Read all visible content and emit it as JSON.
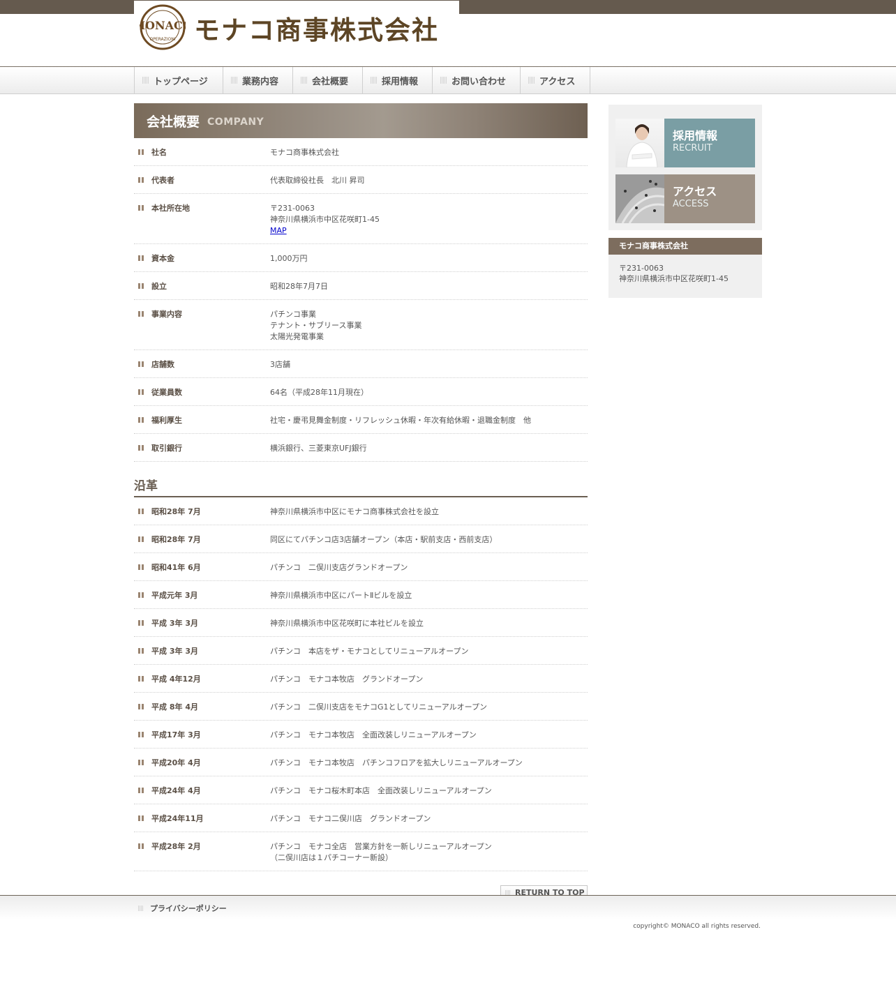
{
  "header": {
    "logo_text": "モナコ商事株式会社",
    "logo_mark_text": "MONACO OPERAZIONI S.P.A."
  },
  "nav": [
    {
      "label": "トップページ"
    },
    {
      "label": "業務内容"
    },
    {
      "label": "会社概要"
    },
    {
      "label": "採用情報"
    },
    {
      "label": "お問い合わせ"
    },
    {
      "label": "アクセス"
    }
  ],
  "page_heading": {
    "ja": "会社概要",
    "en": "COMPANY"
  },
  "company": [
    {
      "label": "社名",
      "lines": [
        "モナコ商事株式会社"
      ]
    },
    {
      "label": "代表者",
      "lines": [
        "代表取締役社長　北川 昇司"
      ]
    },
    {
      "label": "本社所在地",
      "lines": [
        "〒231-0063",
        "神奈川県横浜市中区花咲町1-45"
      ],
      "link": "MAP"
    },
    {
      "label": "資本金",
      "lines": [
        "1,000万円"
      ]
    },
    {
      "label": "設立",
      "lines": [
        "昭和28年7月7日"
      ]
    },
    {
      "label": "事業内容",
      "lines": [
        "パチンコ事業",
        "テナント・サブリース事業",
        "太陽光発電事業"
      ]
    },
    {
      "label": "店舗数",
      "lines": [
        "3店舗"
      ]
    },
    {
      "label": "従業員数",
      "lines": [
        "64名（平成28年11月現在）"
      ]
    },
    {
      "label": "福利厚生",
      "lines": [
        "社宅・慶弔見舞金制度・リフレッシュ休暇・年次有給休暇・退職金制度　他"
      ]
    },
    {
      "label": "取引銀行",
      "lines": [
        "横浜銀行、三菱東京UFJ銀行"
      ]
    }
  ],
  "history_title": "沿革",
  "history": [
    {
      "label": "昭和28年 7月",
      "lines": [
        "神奈川県横浜市中区にモナコ商事株式会社を設立"
      ]
    },
    {
      "label": "昭和28年 7月",
      "lines": [
        "同区にてパチンコ店3店舗オープン（本店・駅前支店・西前支店）"
      ]
    },
    {
      "label": "昭和41年 6月",
      "lines": [
        "パチンコ　二俣川支店グランドオープン"
      ]
    },
    {
      "label": "平成元年 3月",
      "lines": [
        "神奈川県横浜市中区にパートⅡビルを設立"
      ]
    },
    {
      "label": "平成 3年 3月",
      "lines": [
        "神奈川県横浜市中区花咲町に本社ビルを設立"
      ]
    },
    {
      "label": "平成 3年 3月",
      "lines": [
        "パチンコ　本店をザ・モナコとしてリニューアルオープン"
      ]
    },
    {
      "label": "平成 4年12月",
      "lines": [
        "パチンコ　モナコ本牧店　グランドオープン"
      ]
    },
    {
      "label": "平成 8年 4月",
      "lines": [
        "パチンコ　二俣川支店をモナコG1としてリニューアルオープン"
      ]
    },
    {
      "label": "平成17年 3月",
      "lines": [
        "パチンコ　モナコ本牧店　全面改装しリニューアルオープン"
      ]
    },
    {
      "label": "平成20年 4月",
      "lines": [
        "パチンコ　モナコ本牧店　パチンコフロアを拡大しリニューアルオープン"
      ]
    },
    {
      "label": "平成24年 4月",
      "lines": [
        "パチンコ　モナコ桜木町本店　全面改装しリニューアルオープン"
      ]
    },
    {
      "label": "平成24年11月",
      "lines": [
        "パチンコ　モナコ二俣川店　グランドオープン"
      ]
    },
    {
      "label": "平成28年 2月",
      "lines": [
        "パチンコ　モナコ全店　営業方針を一新しリニューアルオープン",
        "（二俣川店は１パチコーナー新設）"
      ]
    }
  ],
  "return_to_top": "RETURN TO TOP",
  "sidebar": {
    "banners": [
      {
        "ja": "採用情報",
        "en": "RECRUIT"
      },
      {
        "ja": "アクセス",
        "en": "ACCESS"
      }
    ],
    "info_title": "モナコ商事株式会社",
    "info_lines": [
      "〒231-0063",
      "神奈川県横浜市中区花咲町1-45"
    ]
  },
  "footer": {
    "privacy": "プライバシーポリシー",
    "copyright": "copyright© MONACO all rights reserved."
  },
  "colors": {
    "topbar": "#655a4e",
    "accent_brown": "#7d6d5e",
    "recruit_banner": "#7a9ea4",
    "access_banner": "#9d9185"
  }
}
